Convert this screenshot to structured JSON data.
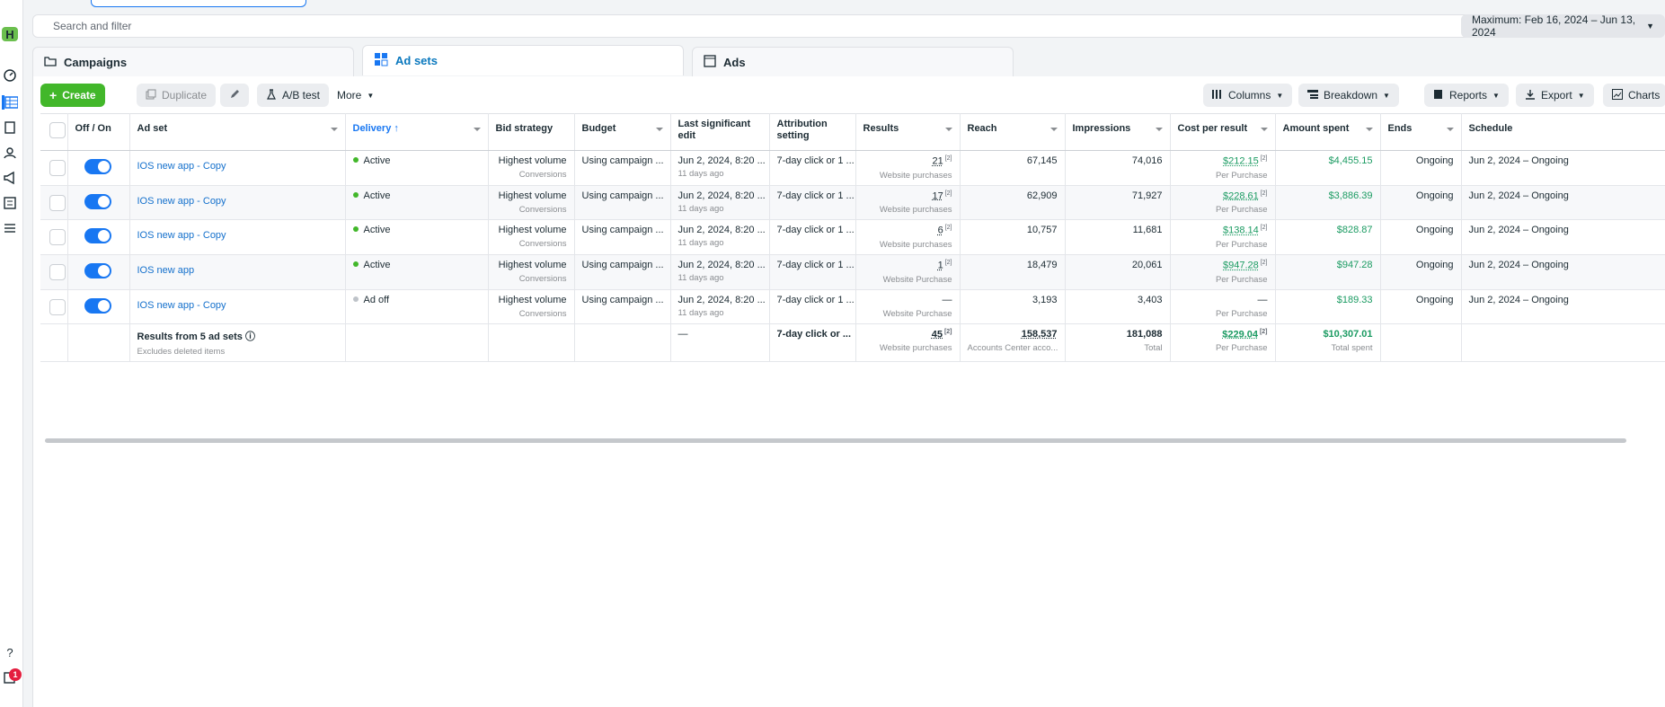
{
  "search": {
    "placeholder": "Search and filter"
  },
  "date_range": "Maximum: Feb 16, 2024 – Jun 13, 2024",
  "rail": {
    "avatar_letter": "H",
    "notification_count": "1"
  },
  "tabs": [
    {
      "label": "Campaigns"
    },
    {
      "label": "Ad sets"
    },
    {
      "label": "Ads"
    }
  ],
  "toolbar": {
    "create": "Create",
    "duplicate": "Duplicate",
    "ab_test": "A/B test",
    "more": "More",
    "columns": "Columns",
    "breakdown": "Breakdown",
    "reports": "Reports",
    "export": "Export",
    "charts": "Charts"
  },
  "columns": {
    "off_on": "Off / On",
    "ad_set": "Ad set",
    "delivery": "Delivery",
    "bid_strategy": "Bid strategy",
    "budget": "Budget",
    "last_edit": "Last significant edit",
    "attribution": "Attribution setting",
    "results": "Results",
    "reach": "Reach",
    "impressions": "Impressions",
    "cost_per_result": "Cost per result",
    "amount_spent": "Amount spent",
    "ends": "Ends",
    "schedule": "Schedule"
  },
  "rows": [
    {
      "name": "IOS new app - Copy",
      "on": true,
      "delivery": "Active",
      "bid": "Highest volume",
      "bid_sub": "Conversions",
      "budget": "Using campaign ...",
      "edit": "Jun 2, 2024, 8:20 ...",
      "edit_sub": "11 days ago",
      "attribution": "7-day click or 1 ...",
      "results": "21",
      "results_sub": "Website purchases",
      "reach": "67,145",
      "impressions": "74,016",
      "cpr": "$212.15",
      "cpr_sub": "Per Purchase",
      "spent": "$4,455.15",
      "ends": "Ongoing",
      "schedule": "Jun 2, 2024 – Ongoing"
    },
    {
      "name": "IOS new app - Copy",
      "on": true,
      "delivery": "Active",
      "bid": "Highest volume",
      "bid_sub": "Conversions",
      "budget": "Using campaign ...",
      "edit": "Jun 2, 2024, 8:20 ...",
      "edit_sub": "11 days ago",
      "attribution": "7-day click or 1 ...",
      "results": "17",
      "results_sub": "Website purchases",
      "reach": "62,909",
      "impressions": "71,927",
      "cpr": "$228.61",
      "cpr_sub": "Per Purchase",
      "spent": "$3,886.39",
      "ends": "Ongoing",
      "schedule": "Jun 2, 2024 – Ongoing"
    },
    {
      "name": "IOS new app - Copy",
      "on": true,
      "delivery": "Active",
      "bid": "Highest volume",
      "bid_sub": "Conversions",
      "budget": "Using campaign ...",
      "edit": "Jun 2, 2024, 8:20 ...",
      "edit_sub": "11 days ago",
      "attribution": "7-day click or 1 ...",
      "results": "6",
      "results_sub": "Website purchases",
      "reach": "10,757",
      "impressions": "11,681",
      "cpr": "$138.14",
      "cpr_sub": "Per Purchase",
      "spent": "$828.87",
      "ends": "Ongoing",
      "schedule": "Jun 2, 2024 – Ongoing"
    },
    {
      "name": "IOS new app",
      "on": true,
      "delivery": "Active",
      "bid": "Highest volume",
      "bid_sub": "Conversions",
      "budget": "Using campaign ...",
      "edit": "Jun 2, 2024, 8:20 ...",
      "edit_sub": "11 days ago",
      "attribution": "7-day click or 1 ...",
      "results": "1",
      "results_sub": "Website Purchase",
      "reach": "18,479",
      "impressions": "20,061",
      "cpr": "$947.28",
      "cpr_sub": "Per Purchase",
      "spent": "$947.28",
      "ends": "Ongoing",
      "schedule": "Jun 2, 2024 – Ongoing"
    },
    {
      "name": "IOS new app - Copy",
      "on": true,
      "delivery": "Ad off",
      "bid": "Highest volume",
      "bid_sub": "Conversions",
      "budget": "Using campaign ...",
      "edit": "Jun 2, 2024, 8:20 ...",
      "edit_sub": "11 days ago",
      "attribution": "7-day click or 1 ...",
      "results": "—",
      "results_sub": "Website Purchase",
      "reach": "3,193",
      "impressions": "3,403",
      "cpr": "—",
      "cpr_sub": "Per Purchase",
      "spent": "$189.33",
      "ends": "Ongoing",
      "schedule": "Jun 2, 2024 – Ongoing"
    }
  ],
  "totals": {
    "label": "Results from 5 ad sets",
    "label_sub": "Excludes deleted items",
    "edit": "—",
    "attribution": "7-day click or ...",
    "results": "45",
    "results_sub": "Website purchases",
    "reach": "158,537",
    "reach_sub": "Accounts Center acco...",
    "impressions": "181,088",
    "impressions_sub": "Total",
    "cpr": "$229.04",
    "cpr_sub": "Per Purchase",
    "spent": "$10,307.01",
    "spent_sub": "Total spent"
  },
  "colors": {
    "accent": "#1877f2",
    "create": "#42b72a",
    "money": "#1b9b62",
    "link": "#1470cc"
  }
}
